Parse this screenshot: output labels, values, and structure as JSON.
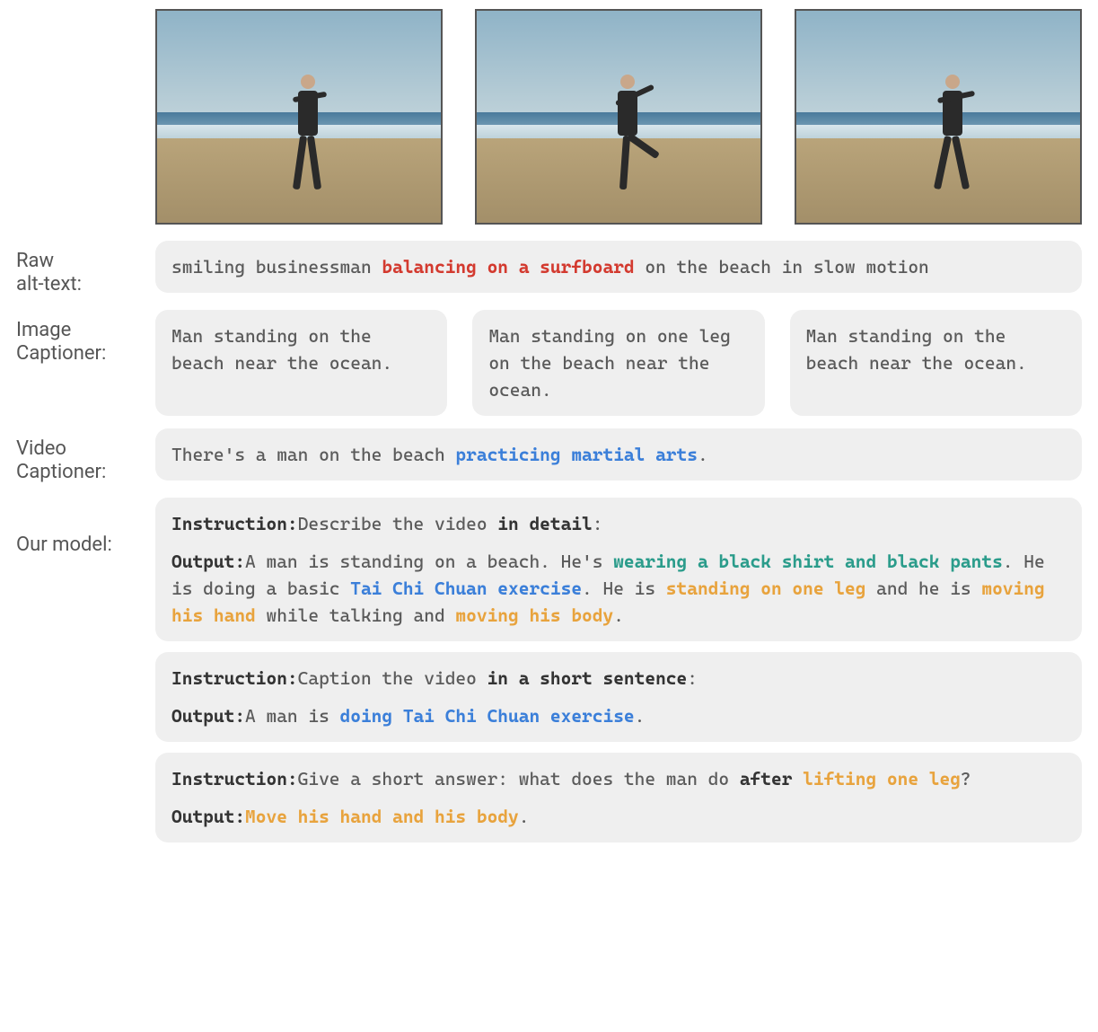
{
  "labels": {
    "raw_alt": "Raw\nalt-text:",
    "image_cap": "Image\nCaptioner:",
    "video_cap": "Video\nCaptioner:",
    "our_model": "Our model:"
  },
  "raw_alt_text": {
    "pre": "smiling businessman ",
    "highlight": "balancing on a surfboard",
    "post": " on the beach in slow motion"
  },
  "image_captions": [
    "Man standing on the beach near the ocean.",
    "Man standing on one leg on the beach near the ocean.",
    "Man standing on the beach near the ocean."
  ],
  "video_caption": {
    "pre": "There's a man on the beach ",
    "highlight": "practicing martial arts",
    "post": "."
  },
  "our_model_blocks": [
    {
      "instruction_label": "Instruction:",
      "instruction_pre": "Describe the video ",
      "instruction_bold": "in detail",
      "instruction_post": ":",
      "output_label": "Output:",
      "segments": [
        {
          "t": "A man is standing on a beach. He's ",
          "c": ""
        },
        {
          "t": "wearing a black shirt and black pants",
          "c": "teal"
        },
        {
          "t": ". He is doing a basic ",
          "c": ""
        },
        {
          "t": "Tai Chi Chuan exercise",
          "c": "blue"
        },
        {
          "t": ". He is ",
          "c": ""
        },
        {
          "t": "standing on one leg",
          "c": "orange"
        },
        {
          "t": " and he is ",
          "c": ""
        },
        {
          "t": "moving his hand",
          "c": "orange"
        },
        {
          "t": " while talking and ",
          "c": ""
        },
        {
          "t": "moving his body",
          "c": "orange"
        },
        {
          "t": ".",
          "c": ""
        }
      ]
    },
    {
      "instruction_label": "Instruction:",
      "instruction_pre": "Caption the video ",
      "instruction_bold": "in a short sentence",
      "instruction_post": ":",
      "output_label": "Output:",
      "segments": [
        {
          "t": "A man is ",
          "c": ""
        },
        {
          "t": "doing Tai Chi Chuan exercise",
          "c": "blue"
        },
        {
          "t": ".",
          "c": ""
        }
      ]
    },
    {
      "instruction_label": "Instruction:",
      "instruction_pre": "Give a short answer: what does the man do ",
      "instruction_bold": "after",
      "instruction_post_seg": [
        {
          "t": " ",
          "c": ""
        },
        {
          "t": "lifting one leg",
          "c": "orange"
        },
        {
          "t": "?",
          "c": ""
        }
      ],
      "output_label": "Output:",
      "segments": [
        {
          "t": "Move his hand and his body",
          "c": "orange"
        },
        {
          "t": ".",
          "c": ""
        }
      ]
    }
  ]
}
